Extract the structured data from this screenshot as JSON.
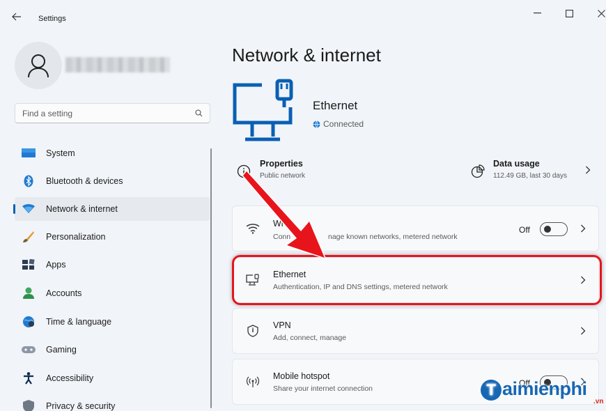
{
  "window": {
    "title": "Settings"
  },
  "user": {
    "name": ""
  },
  "search": {
    "placeholder": "Find a setting"
  },
  "sidebar": {
    "items": [
      {
        "label": "System",
        "icon": "system-icon"
      },
      {
        "label": "Bluetooth & devices",
        "icon": "bluetooth-icon"
      },
      {
        "label": "Network & internet",
        "icon": "network-icon",
        "active": true
      },
      {
        "label": "Personalization",
        "icon": "brush-icon"
      },
      {
        "label": "Apps",
        "icon": "apps-icon"
      },
      {
        "label": "Accounts",
        "icon": "accounts-icon"
      },
      {
        "label": "Time & language",
        "icon": "globe-clock-icon"
      },
      {
        "label": "Gaming",
        "icon": "gamepad-icon"
      },
      {
        "label": "Accessibility",
        "icon": "accessibility-icon"
      },
      {
        "label": "Privacy & security",
        "icon": "shield-icon"
      }
    ]
  },
  "main": {
    "title": "Network & internet",
    "connection": {
      "name": "Ethernet",
      "status": "Connected"
    },
    "properties": {
      "title": "Properties",
      "subtitle": "Public network"
    },
    "data_usage": {
      "title": "Data usage",
      "subtitle": "112.49 GB, last 30 days"
    },
    "cards": {
      "wifi": {
        "title": "Wi-",
        "subtitle_start": "Conn",
        "subtitle_end": "nage known networks, metered network",
        "toggle_label": "Off"
      },
      "ethernet": {
        "title": "Ethernet",
        "subtitle": "Authentication, IP and DNS settings, metered network"
      },
      "vpn": {
        "title": "VPN",
        "subtitle": "Add, connect, manage"
      },
      "hotspot": {
        "title": "Mobile hotspot",
        "subtitle": "Share your internet connection",
        "toggle_label": "Off"
      }
    }
  },
  "watermark": {
    "text": "aimienphi",
    "letter": "T",
    "suffix": ".vn"
  },
  "colors": {
    "accent": "#0a5fb4",
    "highlight": "#e8141c",
    "background": "#f1f4f8"
  }
}
